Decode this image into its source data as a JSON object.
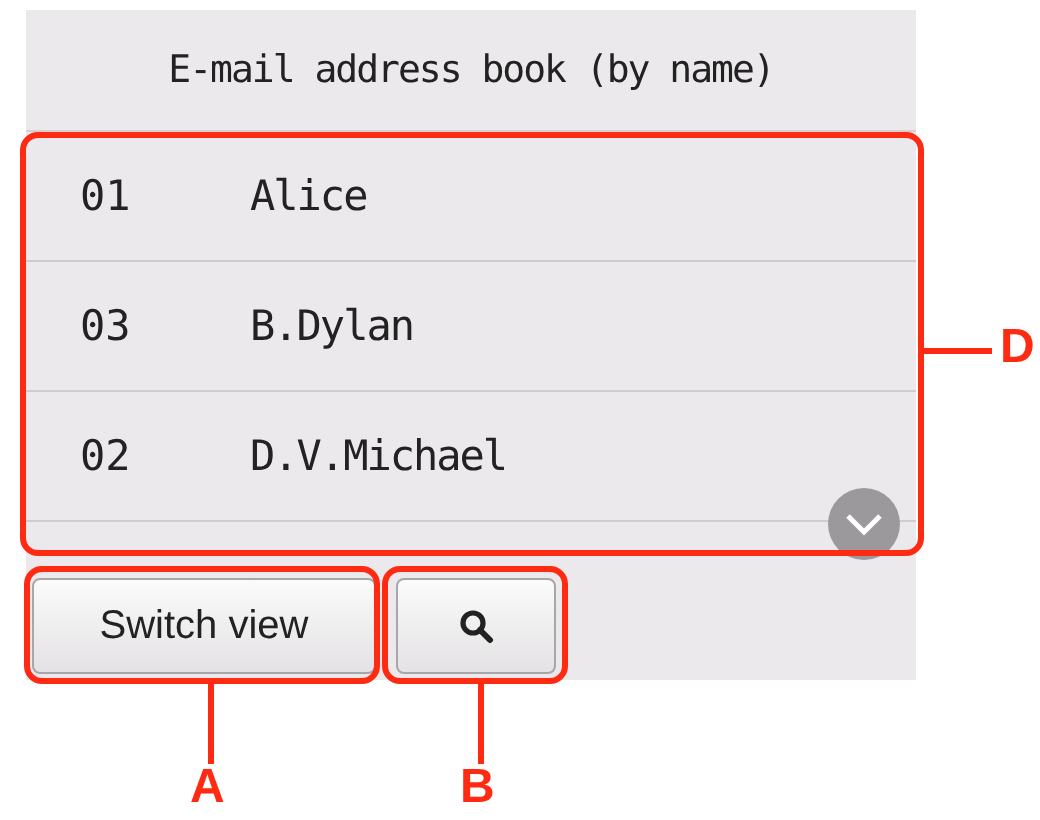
{
  "screen": {
    "title": "E-mail address book (by name)",
    "entries": [
      {
        "number": "01",
        "name": "Alice"
      },
      {
        "number": "03",
        "name": "B.Dylan"
      },
      {
        "number": "02",
        "name": "D.V.Michael"
      }
    ],
    "buttons": [
      {
        "kind": "text",
        "label": "Switch view"
      },
      {
        "kind": "search"
      }
    ]
  },
  "callouts": [
    {
      "label": "D"
    },
    {
      "label": "A"
    },
    {
      "label": "B"
    }
  ]
}
